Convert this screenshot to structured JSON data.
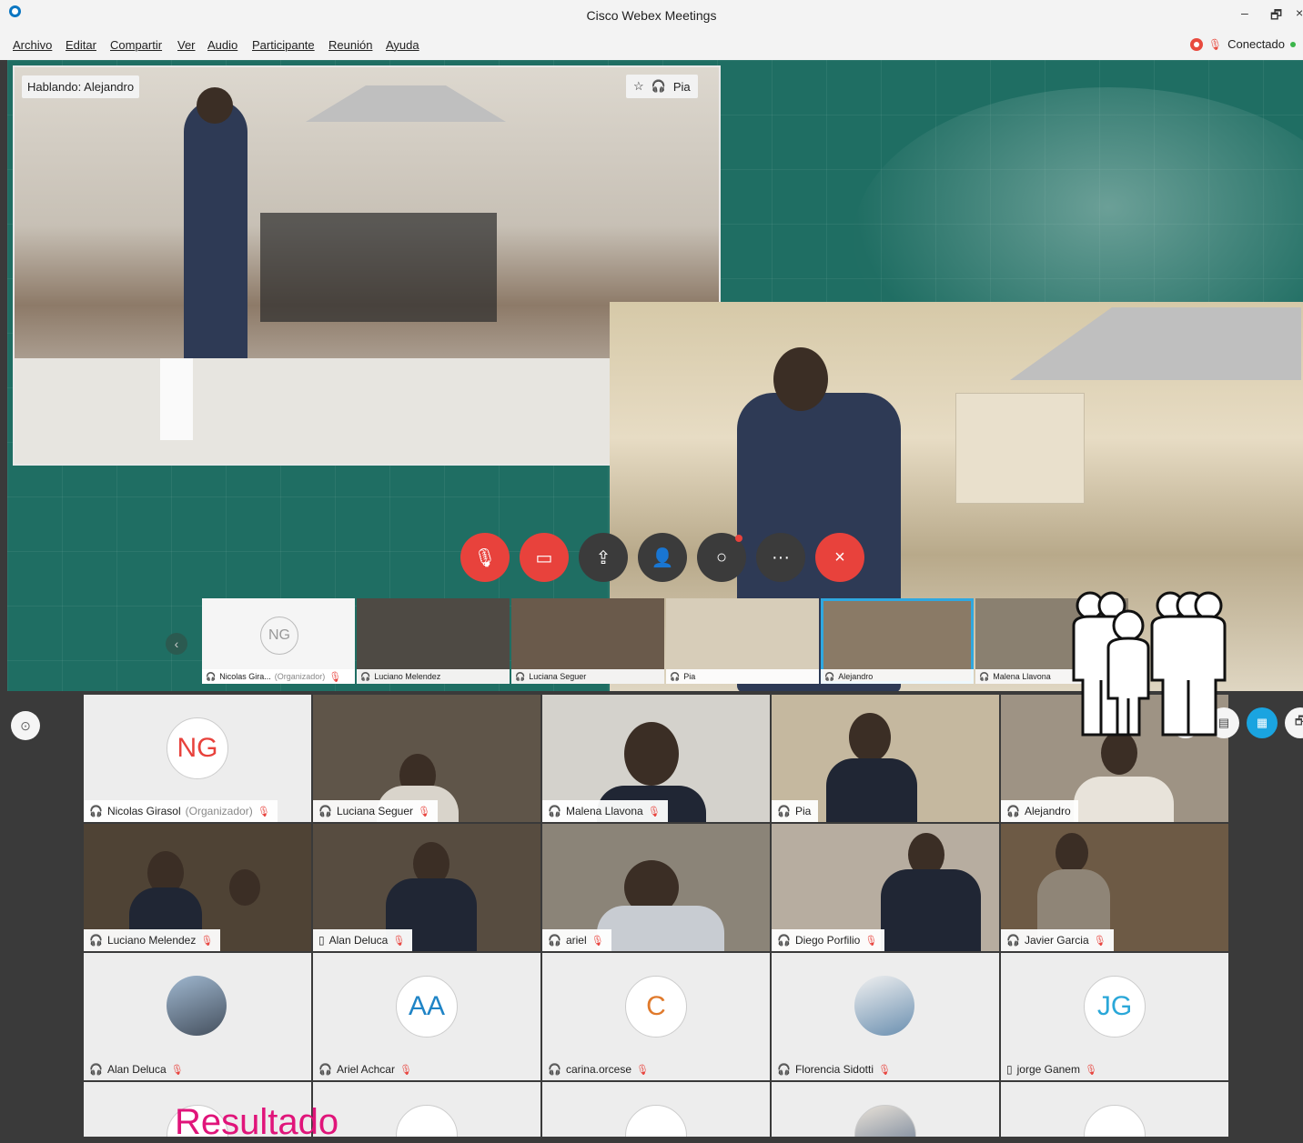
{
  "window": {
    "title": "Cisco Webex Meetings",
    "minimize": "–",
    "restore": "🗗",
    "close": "×"
  },
  "menu": [
    "Archivo",
    "Editar",
    "Compartir",
    "Ver",
    "Audio",
    "Participante",
    "Reunión",
    "Ayuda"
  ],
  "status": {
    "label": "Conectado"
  },
  "stage": {
    "speaking": "Hablando: Alejandro",
    "pinned_name": "Pia"
  },
  "controls": {
    "mute": "mute-mic-icon",
    "video": "camera-off-icon",
    "share": "share-icon",
    "participants": "participants-icon",
    "chat": "chat-icon",
    "more": "···",
    "leave": "×"
  },
  "filmstrip": [
    {
      "initials": "NG",
      "name": "Nicolas Gira...",
      "role": "(Organizador)"
    },
    {
      "name": "Luciano Melendez"
    },
    {
      "name": "Luciana Seguer"
    },
    {
      "name": "Pia"
    },
    {
      "name": "Alejandro"
    },
    {
      "name": "Malena Llavona"
    }
  ],
  "grid": [
    {
      "name": "Nicolas Girasol",
      "role": "(Organizador)",
      "initials": "NG"
    },
    {
      "name": "Luciana Seguer"
    },
    {
      "name": "Malena Llavona"
    },
    {
      "name": "Pia"
    },
    {
      "name": "Alejandro"
    },
    {
      "name": "Luciano Melendez"
    },
    {
      "name": "Alan Deluca"
    },
    {
      "name": "ariel"
    },
    {
      "name": "Diego Porfilio"
    },
    {
      "name": "Javier Garcia"
    },
    {
      "name": "Alan Deluca"
    },
    {
      "name": "Ariel Achcar",
      "initials": "AA"
    },
    {
      "name": "carina.orcese",
      "initials": "C"
    },
    {
      "name": "Florencia Sidotti"
    },
    {
      "name": "jorge Ganem",
      "initials": "JG"
    }
  ],
  "overlay": {
    "text": "Resultado"
  },
  "colors": {
    "accent": "#1aa4e0",
    "danger": "#e8423c",
    "stage_bg": "#1f6e63",
    "overlay_text": "#e0157a"
  }
}
